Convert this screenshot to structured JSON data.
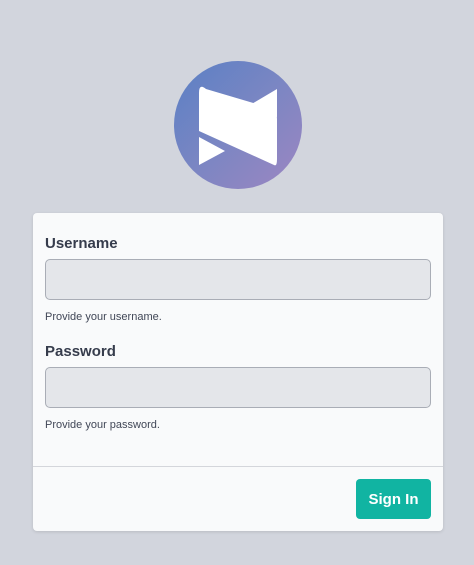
{
  "brand": {
    "logo_icon": "brand-n-logo-icon",
    "gradient_start": "#5a80c4",
    "gradient_end": "#9d86c1"
  },
  "form": {
    "username": {
      "label": "Username",
      "value": "",
      "placeholder": "",
      "help": "Provide your username."
    },
    "password": {
      "label": "Password",
      "value": "",
      "placeholder": "",
      "help": "Provide your password."
    },
    "submit_label": "Sign In"
  },
  "colors": {
    "background": "#d2d5dd",
    "card": "#f9fafb",
    "input_background": "#e4e6ea",
    "primary_button": "#11b4a2"
  }
}
